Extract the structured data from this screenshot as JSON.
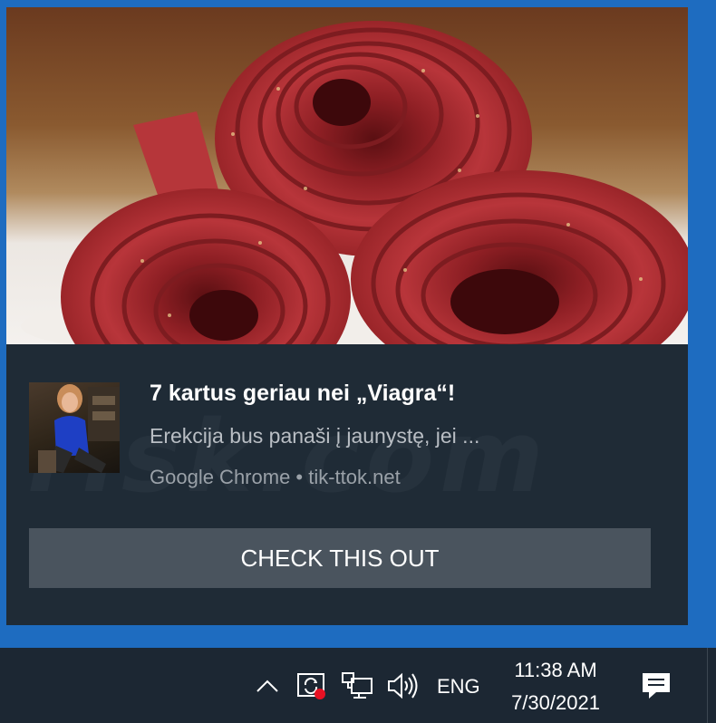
{
  "notification": {
    "hero_image": "fruit-leather-rolls-image",
    "avatar_image": "sender-photo",
    "title": "7 kartus geriau nei „Viagra“!",
    "message": "Erekcija bus panaši į jaunystę, jei ...",
    "source": "Google Chrome • tik-ttok.net",
    "action_button": "CHECK THIS OUT"
  },
  "watermark": "risk.com",
  "taskbar": {
    "icons": [
      "chevron-up-icon",
      "sync-alert-icon",
      "network-icon",
      "volume-icon",
      "action-center-icon"
    ],
    "language": "ENG",
    "time": "11:38 AM",
    "date": "7/30/2021"
  },
  "colors": {
    "desktop": "#1e6cc0",
    "toast_bg": "#1f2b36",
    "button_bg": "#4a545e",
    "taskbar_bg": "#1c2733",
    "alert_dot": "#e81123"
  }
}
